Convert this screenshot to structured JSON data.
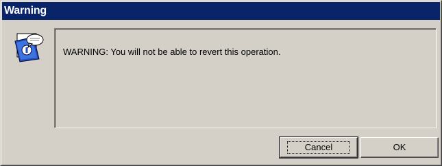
{
  "window": {
    "title": "Warning"
  },
  "dialog": {
    "icon": "warning-info-icon",
    "message": "WARNING: You will not be able to revert this operation."
  },
  "buttons": {
    "cancel_label": "Cancel",
    "ok_label": "OK"
  },
  "colors": {
    "title_bar": "#0a246a",
    "face": "#d4d0c8"
  }
}
